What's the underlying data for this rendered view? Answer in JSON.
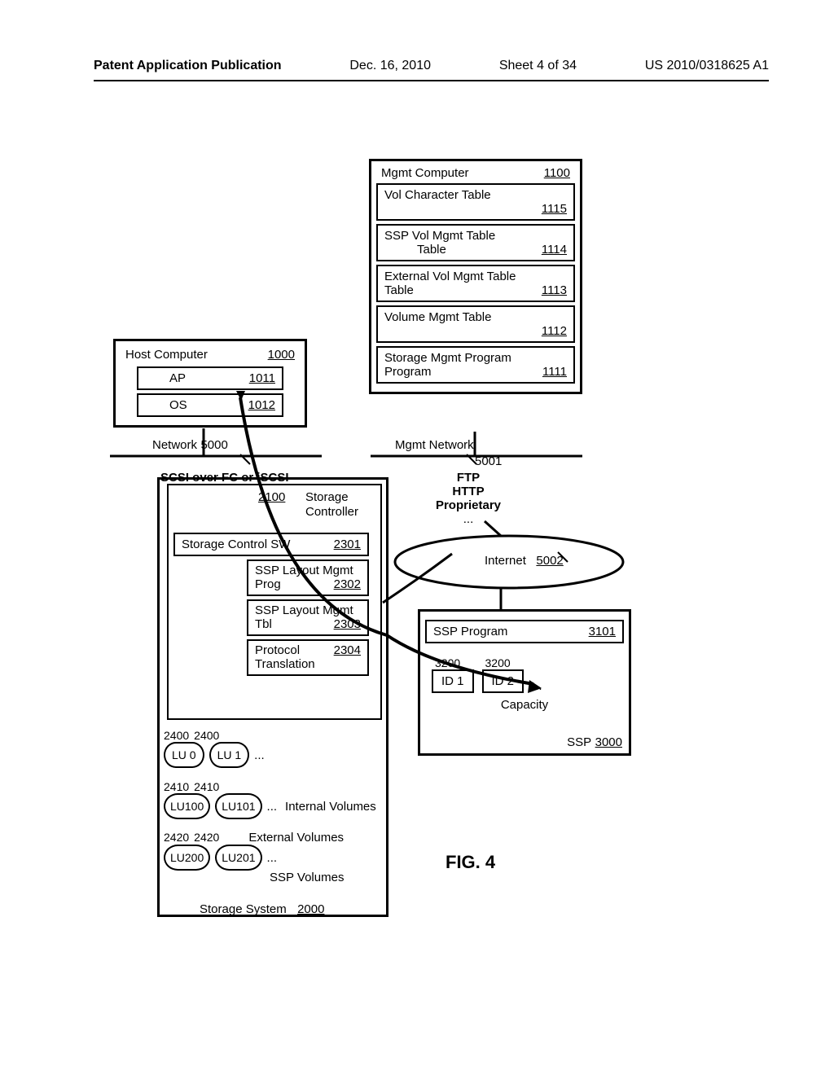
{
  "header": {
    "left": "Patent Application Publication",
    "date": "Dec. 16, 2010",
    "sheet": "Sheet 4 of 34",
    "id": "US 2010/0318625 A1"
  },
  "mgmt_computer": {
    "title": "Mgmt Computer",
    "num": "1100",
    "items": [
      {
        "label": "Vol Character Table",
        "num": "1115"
      },
      {
        "label": "SSP Vol Mgmt Table",
        "num": "1114"
      },
      {
        "label": "External Vol Mgmt Table",
        "num": "1113"
      },
      {
        "label": "Volume Mgmt Table",
        "num": "1112"
      },
      {
        "label": "Storage Mgmt Program",
        "num": "1111"
      }
    ]
  },
  "host_computer": {
    "title": "Host Computer",
    "num": "1000",
    "items": [
      {
        "label": "AP",
        "num": "1011"
      },
      {
        "label": "OS",
        "num": "1012"
      }
    ]
  },
  "network": {
    "label": "Network",
    "num": "5000"
  },
  "mgmt_network": {
    "label": "Mgmt Network",
    "num": "5001"
  },
  "scsi": "SCSI over FC or iSCSI",
  "protocols": {
    "p1": "FTP",
    "p2": "HTTP",
    "p3": "Proprietary"
  },
  "storage_controller": {
    "num": "2100",
    "label": "Storage Controller",
    "items": [
      {
        "label": "Storage Control SW",
        "num": "2301"
      },
      {
        "label": "SSP Layout Mgmt Prog",
        "num": "2302"
      },
      {
        "label": "SSP Layout Mgmt Tbl",
        "num": "2303"
      },
      {
        "label": "Protocol Translation",
        "num": "2304"
      }
    ]
  },
  "internet": {
    "label": "Internet",
    "num": "5002"
  },
  "ssp": {
    "prog": "SSP Program",
    "prog_num": "3101",
    "ids": [
      {
        "label": "ID 1",
        "num": "3200"
      },
      {
        "label": "ID 2",
        "num": "3200"
      }
    ],
    "capacity": "Capacity",
    "label": "SSP",
    "num": "3000"
  },
  "storage_system": {
    "label": "Storage System",
    "num": "2000",
    "lus_row1": [
      {
        "label": "LU 0",
        "num": "2400"
      },
      {
        "label": "LU 1",
        "num": "2400"
      }
    ],
    "lus_row2": [
      {
        "label": "LU100",
        "num": "2410"
      },
      {
        "label": "LU101",
        "num": "2410"
      }
    ],
    "lus_row3": [
      {
        "label": "LU200",
        "num": "2420"
      },
      {
        "label": "LU201",
        "num": "2420"
      }
    ],
    "internal": "Internal Volumes",
    "external": "External Volumes",
    "sspvol": "SSP Volumes"
  },
  "fig": "FIG. 4",
  "ellipsis": "..."
}
